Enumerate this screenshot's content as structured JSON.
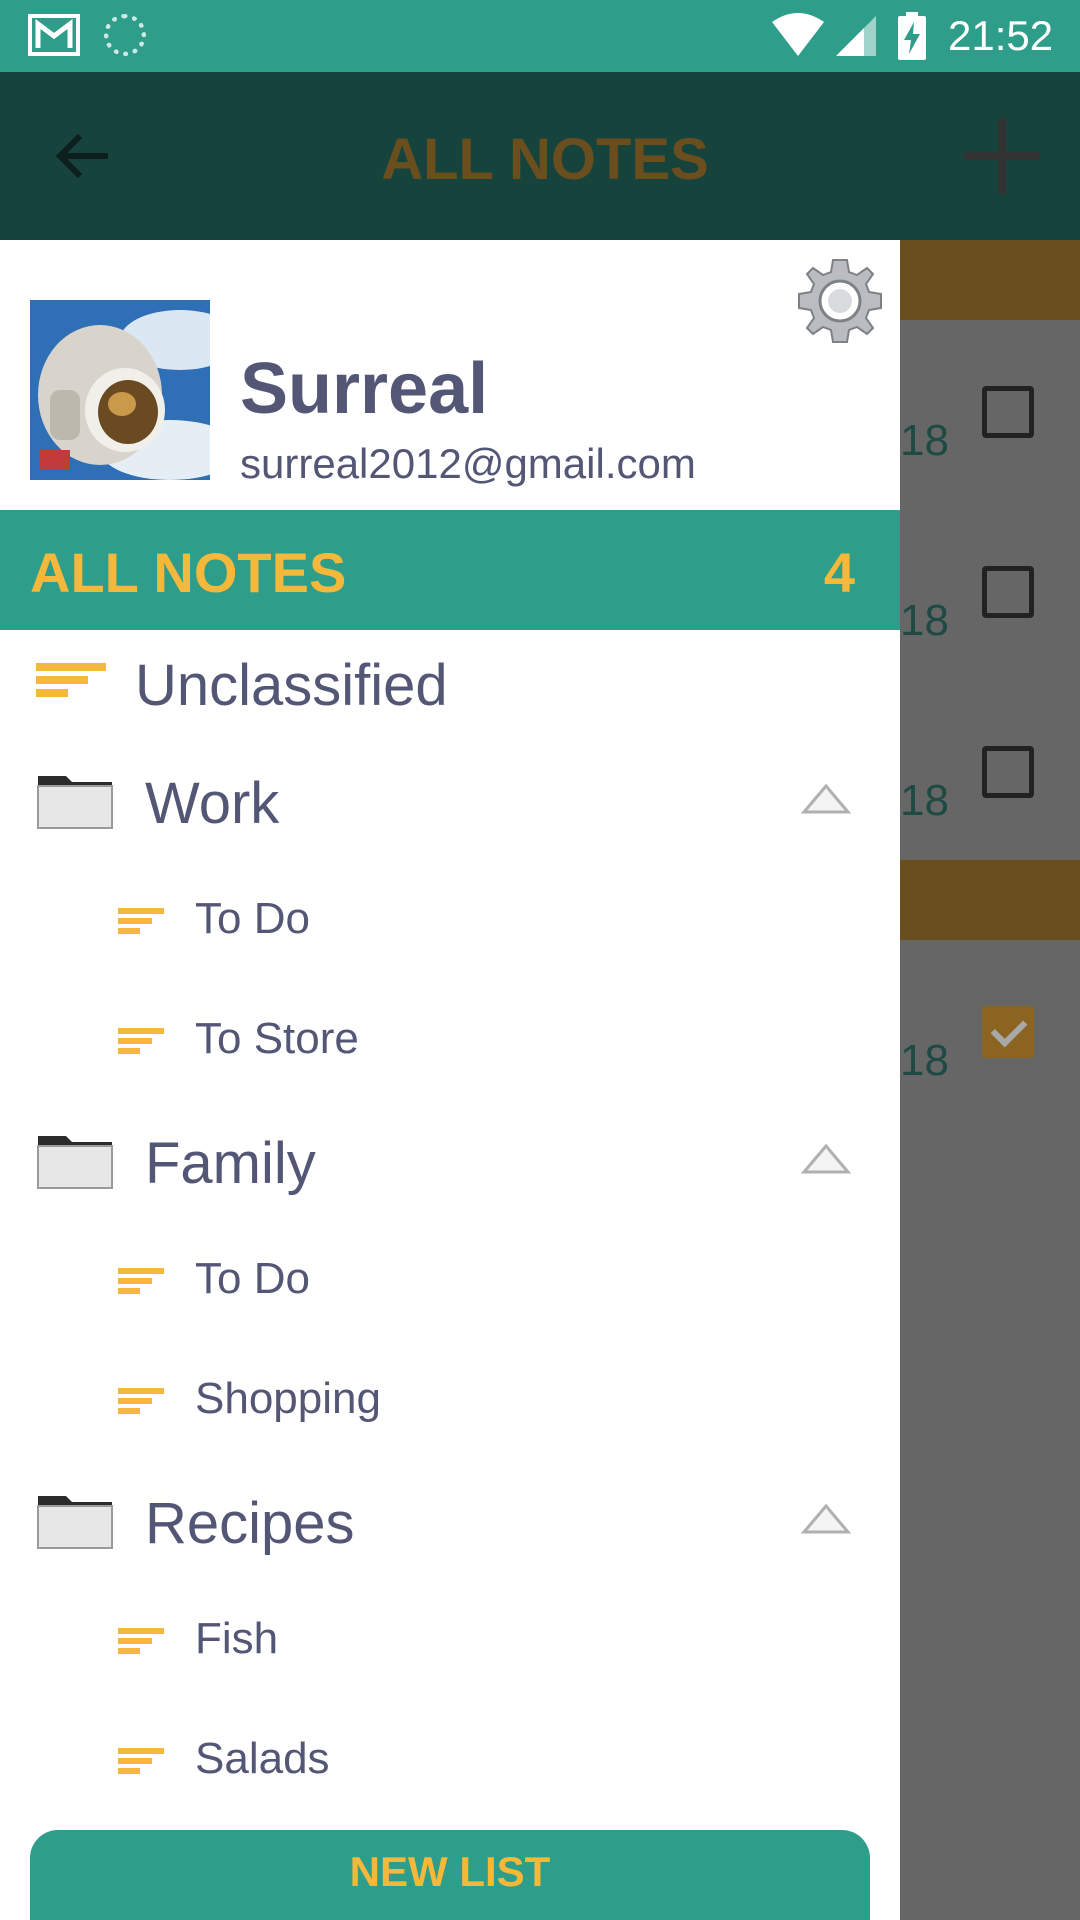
{
  "status_bar": {
    "time": "21:52",
    "icons": [
      "gmail-icon",
      "sync-icon",
      "wifi-icon",
      "signal-icon",
      "battery-charging-icon"
    ]
  },
  "toolbar": {
    "title": "ALL NOTES",
    "back_icon": "arrow-left-icon",
    "add_icon": "plus-icon"
  },
  "background_list": {
    "dates": [
      "18",
      "18",
      "18",
      "18"
    ],
    "checkbox_states": [
      false,
      false,
      false,
      true
    ]
  },
  "drawer": {
    "profile": {
      "name": "Surreal",
      "email": "surreal2012@gmail.com",
      "avatar": "astronaut-photo",
      "settings_icon": "gear-icon"
    },
    "all_notes": {
      "label": "ALL NOTES",
      "count": "4"
    },
    "unclassified": {
      "label": "Unclassified"
    },
    "folders": [
      {
        "label": "Work",
        "expanded": true,
        "lists": [
          {
            "label": "To Do"
          },
          {
            "label": "To Store"
          }
        ]
      },
      {
        "label": "Family",
        "expanded": true,
        "lists": [
          {
            "label": "To Do"
          },
          {
            "label": "Shopping"
          }
        ]
      },
      {
        "label": "Recipes",
        "expanded": true,
        "lists": [
          {
            "label": "Fish"
          },
          {
            "label": "Salads"
          }
        ]
      }
    ],
    "new_list_button": "NEW LIST"
  },
  "colors": {
    "teal": "#2e9e8a",
    "accent": "#f5b83a",
    "text": "#535675",
    "scrim": "#666666",
    "toolbar_dim": "#16443c",
    "header_dim": "#6b4e1e"
  }
}
